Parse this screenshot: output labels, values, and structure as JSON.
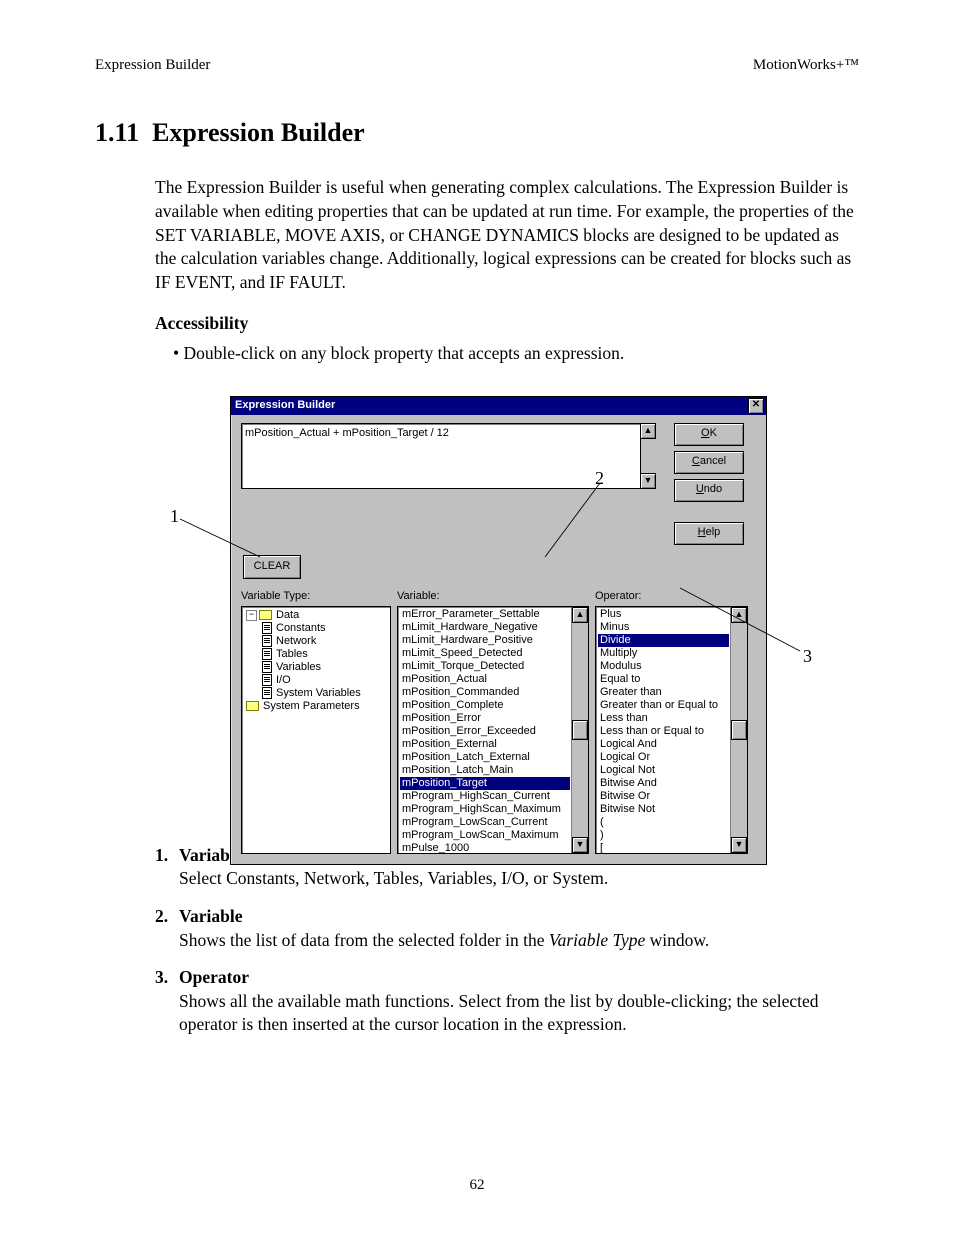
{
  "header": {
    "left": "Expression Builder",
    "right": "MotionWorks+™"
  },
  "page_number": "62",
  "section": {
    "number": "1.11",
    "title": "Expression Builder",
    "intro": "The Expression Builder is useful when generating complex calculations.  The Expression Builder is available when editing properties that can be updated at run time.  For example, the properties of the SET VARIABLE, MOVE AXIS, or CHANGE DYNAMICS blocks are designed to be updated as the calculation variables change.  Additionally, logical expressions can be created for blocks such as IF EVENT, and IF FAULT.",
    "accessibility_head": "Accessibility",
    "accessibility_bullet": "•  Double-click on any block property that accepts an expression."
  },
  "callouts": {
    "c1": "1",
    "c2": "2",
    "c3": "3"
  },
  "dialog": {
    "title": "Expression Builder",
    "expression": "mPosition_Actual + mPosition_Target / 12",
    "buttons": {
      "ok": "OK",
      "cancel": "Cancel",
      "undo": "Undo",
      "help": "Help",
      "clear": "CLEAR"
    },
    "labels": {
      "variable_type": "Variable Type:",
      "variable": "Variable:",
      "operator": "Operator:"
    },
    "tree": [
      {
        "level": 0,
        "icon": "folder-open",
        "text": "Data"
      },
      {
        "level": 1,
        "icon": "file",
        "text": "Constants"
      },
      {
        "level": 1,
        "icon": "file",
        "text": "Network"
      },
      {
        "level": 1,
        "icon": "file",
        "text": "Tables"
      },
      {
        "level": 1,
        "icon": "file",
        "text": "Variables"
      },
      {
        "level": 1,
        "icon": "file",
        "text": "I/O"
      },
      {
        "level": 1,
        "icon": "file",
        "text": "System Variables"
      },
      {
        "level": 0,
        "icon": "folder-closed",
        "text": "System Parameters"
      }
    ],
    "variable_list": [
      "mError_Parameter_Settable",
      "mLimit_Hardware_Negative",
      "mLimit_Hardware_Positive",
      "mLimit_Speed_Detected",
      "mLimit_Torque_Detected",
      "mPosition_Actual",
      "mPosition_Commanded",
      "mPosition_Complete",
      "mPosition_Error",
      "mPosition_Error_Exceeded",
      "mPosition_External",
      "mPosition_Latch_External",
      "mPosition_Latch_Main",
      "mPosition_Target",
      "mProgram_HighScan_Current",
      "mProgram_HighScan_Maximum",
      "mProgram_LowScan_Current",
      "mProgram_LowScan_Maximum",
      "mPulse_1000"
    ],
    "variable_selected": "mPosition_Target",
    "operator_list": [
      "Plus",
      "Minus",
      "Divide",
      "Multiply",
      "Modulus",
      "Equal to",
      "Greater than",
      "Greater than or Equal to",
      "Less than",
      "Less than or Equal to",
      "Logical And",
      "Logical Or",
      "Logical Not",
      "Bitwise And",
      "Bitwise Or",
      "Bitwise Not",
      "(",
      ")",
      "["
    ],
    "operator_selected": "Divide"
  },
  "defs": [
    {
      "n": "1.",
      "title": "Variable Type",
      "body_html": "Select Constants, Network, Tables, Variables, I/O, or System."
    },
    {
      "n": "2.",
      "title": "Variable",
      "body_html": " Shows the list of data from the selected folder in the <em class=\"italic\">Variable Type</em> window."
    },
    {
      "n": "3.",
      "title": "Operator",
      "body_html": "Shows all the available math functions.  Select from the list by double-clicking; the selected operator is then inserted at the cursor location in the expression."
    }
  ]
}
